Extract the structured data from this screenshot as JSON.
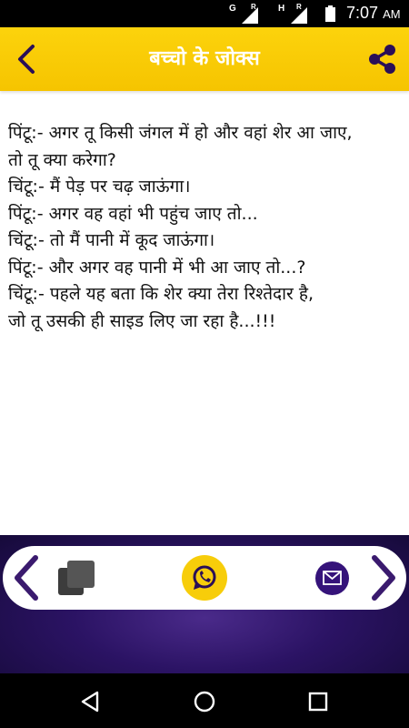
{
  "status_bar": {
    "sim1_label": "G",
    "sim1_roaming": "R",
    "sim2_label": "H",
    "sim2_roaming": "R",
    "time": "7:07",
    "ampm": "AM"
  },
  "app_bar": {
    "title": "बच्चो के जोक्स",
    "back_icon": "chevron-left-icon",
    "share_icon": "share-icon"
  },
  "joke": {
    "lines": [
      "पिंटू:- अगर तू किसी जंगल में हो और वहां शेर आ जाए,",
      "तो तू क्या करेगा?",
      "चिंटू:- मैं पेड़ पर चढ़ जाऊंगा।",
      "पिंटू:- अगर वह वहां भी पहुंच जाए तो...",
      "चिंटू:- तो मैं पानी में कूद जाऊंगा।",
      "पिंटू:- और अगर वह पानी में भी आ जाए तो...?",
      "चिंटू:- पहले यह बता कि शेर क्या तेरा रिश्तेदार है,",
      "जो तू उसकी ही साइड लिए जा रहा है...!!!"
    ]
  },
  "toolbar": {
    "prev_icon": "chevron-left-icon",
    "copy_icon": "copy-icon",
    "whatsapp_icon": "whatsapp-icon",
    "mail_icon": "mail-icon",
    "next_icon": "chevron-right-icon"
  },
  "nav_bar": {
    "back_icon": "triangle-back-icon",
    "home_icon": "circle-home-icon",
    "recents_icon": "square-recents-icon"
  },
  "colors": {
    "accent_yellow": "#f6c400",
    "deep_purple": "#35137a",
    "arrow_purple": "#3a1a6e"
  }
}
